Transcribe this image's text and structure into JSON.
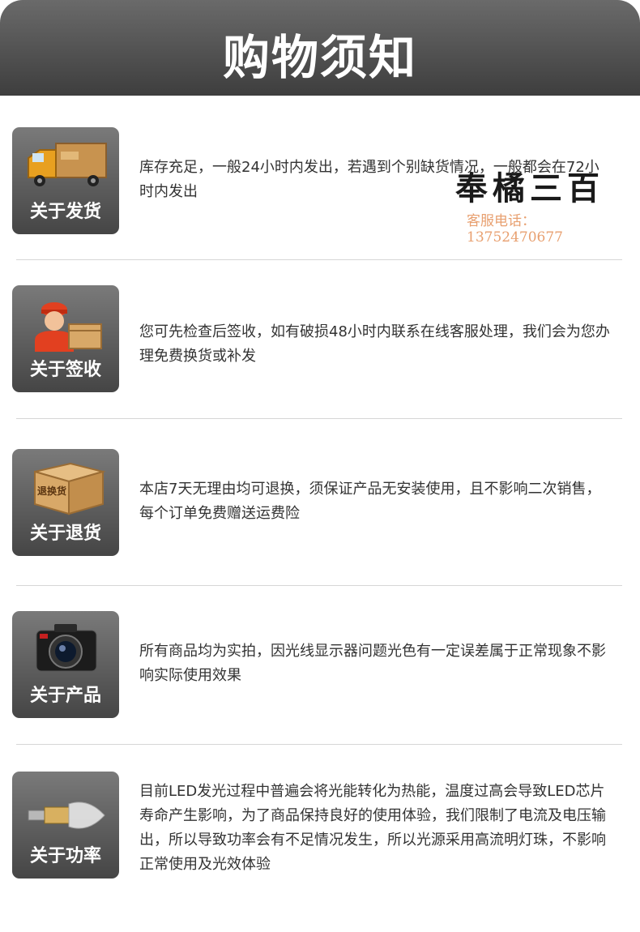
{
  "header": {
    "title": "购物须知"
  },
  "items": [
    {
      "label": "关于发货",
      "icon": "delivery-truck-icon",
      "text": "库存充足，一般24小时内发出，若遇到个别缺货情况，一般都会在72小时内发出"
    },
    {
      "label": "关于签收",
      "icon": "courier-with-package-icon",
      "text": "您可先检查后签收，如有破损48小时内联系在线客服处理，我们会为您办理免费换货或补发"
    },
    {
      "label": "关于退货",
      "icon": "return-box-icon",
      "box_text": "退换货",
      "text": "本店7天无理由均可退换，须保证产品无安装使用，且不影响二次销售，每个订单免费赠送运费险"
    },
    {
      "label": "关于产品",
      "icon": "camera-icon",
      "text": "所有商品均为实拍，因光线显示器问题光色有一定误差属于正常现象不影响实际使用效果"
    },
    {
      "label": "关于功率",
      "icon": "led-bulb-icon",
      "text": "目前LED发光过程中普遍会将光能转化为热能，温度过高会导致LED芯片寿命产生影响，为了商品保持良好的使用体验，我们限制了电流及电压输出，所以导致功率会有不足情况发生，所以光源采用高流明灯珠，不影响正常使用及光效体验"
    }
  ],
  "watermark": {
    "name": "奉橘三百",
    "phone": "客服电话：13752470677"
  }
}
